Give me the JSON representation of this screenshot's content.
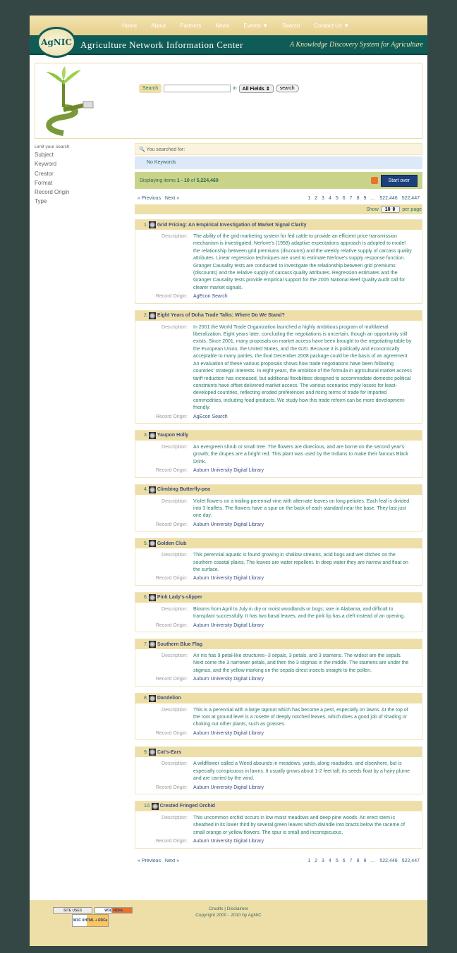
{
  "nav": [
    "Home",
    "About",
    "Partners",
    "News",
    "Events ▼",
    "Search",
    "Contact Us ▼"
  ],
  "header": {
    "logo": "AgNIC",
    "title": "Agriculture Network Information Center",
    "tagline": "A Knowledge Discovery System for Agriculture"
  },
  "search": {
    "label": "Search",
    "value": "",
    "in": "in",
    "field": "All Fields",
    "button": "search"
  },
  "sidebar": {
    "heading": "Limit your search",
    "facets": [
      "Subject",
      "Keyword",
      "Creator",
      "Format",
      "Record Origin",
      "Type"
    ]
  },
  "summary": {
    "you_searched": "You searched for:",
    "keywords": "No Keywords",
    "displaying": "Displaying items",
    "range": "1 - 10",
    "of": "of",
    "total": "5,224,469",
    "start_over": "Start over"
  },
  "pager": {
    "prev": "« Previous",
    "next": "Next »",
    "pages": [
      "1",
      "2",
      "3",
      "4",
      "5",
      "6",
      "7",
      "8",
      "9",
      "…",
      "522,446",
      "522,447"
    ],
    "show": "Show",
    "per_page_value": "10",
    "per_page": "per page"
  },
  "labels": {
    "description": "Description:",
    "origin": "Record Origin:"
  },
  "results": [
    {
      "num": "1.",
      "title": "Grid Pricing: An Empirical Investigation of Market Signal Clarity",
      "description": "The ability of the grid marketing system for fed cattle to provide an efficient price transmission mechanism is investigated. Nerlove's (1958) adaptive expectations approach is adopted to model the relationship between grid premiums (discounts) and the weekly relative supply of carcass quality attributes. Linear regression techniques are used to estimate Nerlove's supply response function. Granger Causality tests are conducted to investigate the relationship between grid premiums (discounts) and the relative supply of carcass quality attributes. Regression estimates and the Granger Causality tests provide empirical support for the 2005 National Beef Quality Audit call for clearer market signals.",
      "origin": "AgEcon Search"
    },
    {
      "num": "2.",
      "title": "Eight Years of Doha Trade Talks: Where Do We Stand?",
      "description": "In 2001 the World Trade Organization launched a highly ambitious program of multilateral liberalization. Eight years later, concluding the negotiations is uncertain, though an opportunity still exists. Since 2001, many proposals on market access have been brought to the negotiating table by the European Union, the United States, and the G20. Because it is politically and economically acceptable to many parties, the final December 2008 package could be the basis of an agreement. An evaluation of these various proposals shows how trade negotiations have been following countries' strategic interests. In eight years, the ambition of the formula in agricultural market access tariff reduction has increased, but additional flexibilities designed to accommodate domestic political constraints have offset delivered market access. The various scenarios imply losses for least-developed countries, reflecting eroded preferences and rising terms of trade for imported commodities, including food products. We study how this trade reform can be more development-friendly.",
      "origin": "AgEcon Search"
    },
    {
      "num": "3.",
      "title": "Yaupon Holly",
      "description": "An evergreen shrub or small tree. The flowers are dioecious, and are borne on the second year's growth; the drupes are a bright red. This plant was used by the Indians to make their famous Black Drink.",
      "origin": "Auburn University Digital Library"
    },
    {
      "num": "4.",
      "title": "Climbing Butterfly-pea",
      "description": "Violet flowers on a trailing perennial vine with alternate leaves on long petioles. Each leaf is divided into 3 leaflets. The flowers have a spur on the back of each standard near the base. They last just one day.",
      "origin": "Auburn University Digital Library"
    },
    {
      "num": "5.",
      "title": "Golden Club",
      "description": "This perennial aquatic is found growing in shallow streams, acid bogs and wet ditches on the southern coastal plains. The leaves are water repellent. In deep water they are narrow and float on the surface.",
      "origin": "Auburn University Digital Library"
    },
    {
      "num": "6.",
      "title": "Pink Lady's-slipper",
      "description": "Blooms from April to July in dry or moist woodlands or bogs; rare in Alabama, and difficult to transplant successfully. It has two basal leaves, and the pink lip has a cleft instead of an opening.",
      "origin": "Auburn University Digital Library"
    },
    {
      "num": "7.",
      "title": "Southern Blue Flag",
      "description": "An iris has 9 petal-like structures--3 sepals, 3 petals, and 3 stamens. The widest are the sepals. Next come the 3 narrower petals, and then the 3 stigmas in the middle. The stamens are under the stigmas, and the yellow marking on the sepals direct insects straight to the pollen.",
      "origin": "Auburn University Digital Library"
    },
    {
      "num": "8.",
      "title": "Dandelion",
      "description": "This is a perennial with a large taproot which has become a pest, especially on lawns. At the top of the root at ground level is a rosette of deeply notched leaves, which does a good job of shading or choking out other plants, such as grasses.",
      "origin": "Auburn University Digital Library"
    },
    {
      "num": "9.",
      "title": "Cat's-Ears",
      "description": "A wildflower called a Weed abounds in meadows, yards, along roadsides, and elsewhere, but is especially conspicuous in lawns. It usually grows about 1-2 feet tall; its seeds float by a hairy plume and are carried by the wind.",
      "origin": "Auburn University Digital Library"
    },
    {
      "num": "10.",
      "title": "Crested Fringed Orchid",
      "description": "This uncommon orchid occurs in low moist meadows and deep pine woods. An erect stem is sheathed in its lower third by several green leaves which dwindle into bracts below the raceme of small orange or yellow flowers. The spur is small and inconspicuous.",
      "origin": "Auburn University Digital Library"
    }
  ],
  "footer": {
    "credits": "Credits",
    "sep": "|",
    "disclaimer": "Disclaimer",
    "copyright": "Copyright 2000 - 2010 by AgNIC",
    "badge_site_uses": "SITE USES",
    "badge_w3c_rdfa": "W3C RDFa",
    "badge_xhtml": "W3C XHTML + RDFa"
  }
}
